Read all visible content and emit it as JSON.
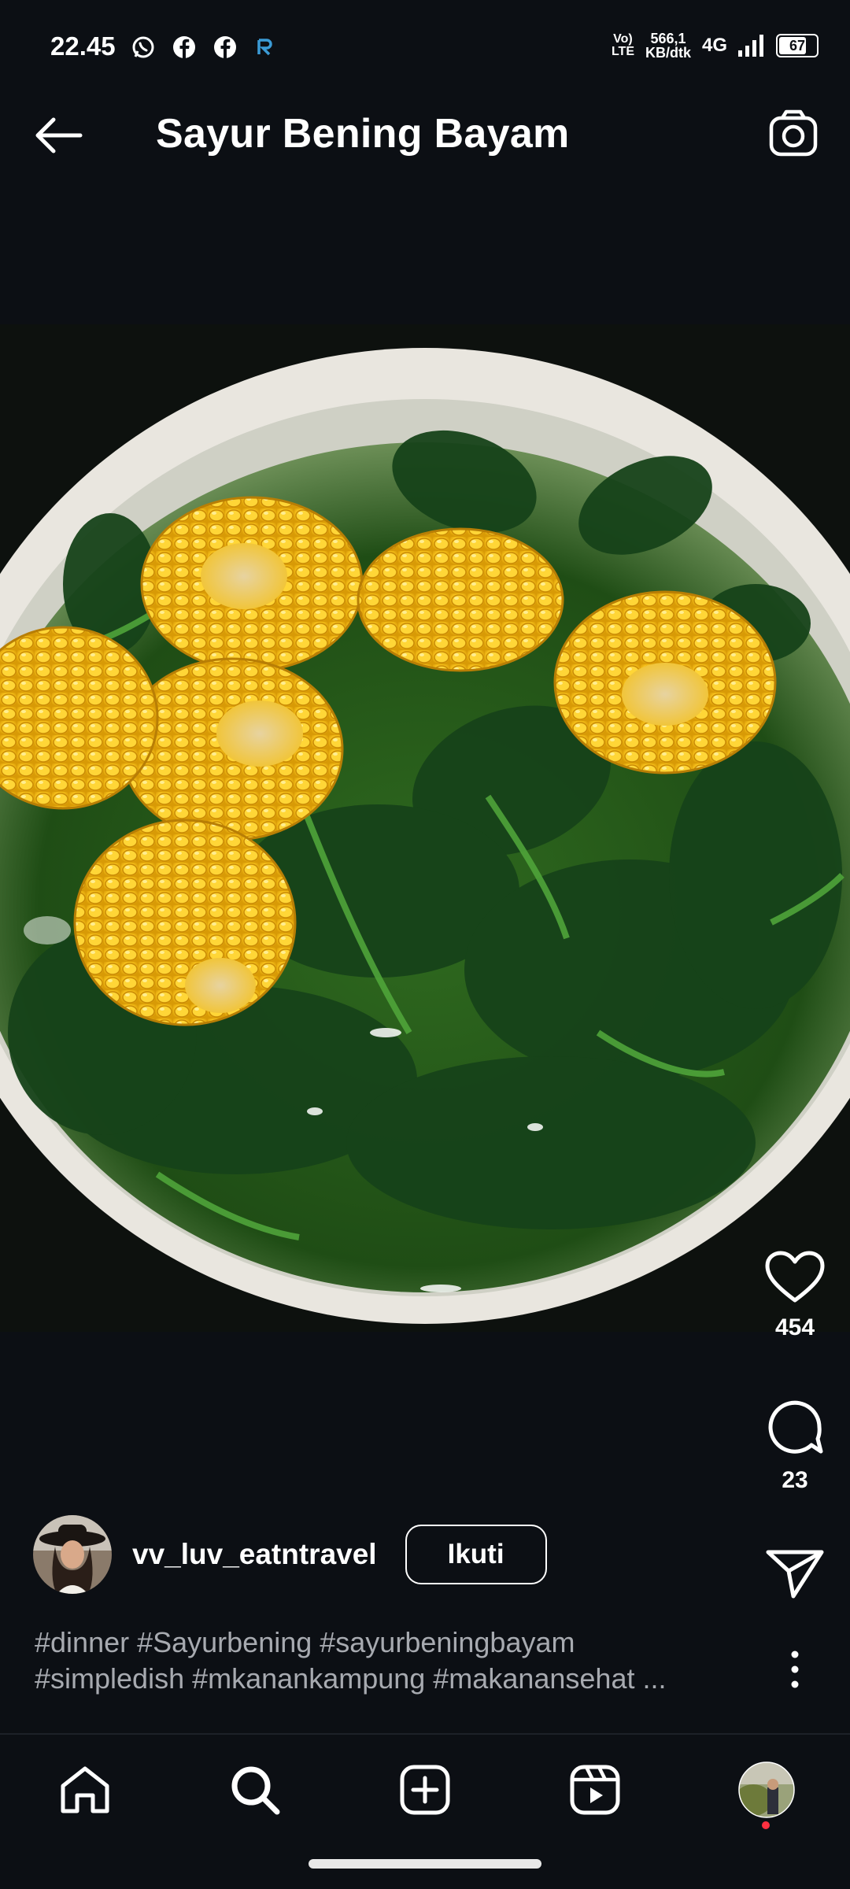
{
  "status_bar": {
    "time": "22.45",
    "icons": [
      "whatsapp-icon",
      "facebook-icon",
      "facebook-icon",
      "cast-icon"
    ],
    "volte": "Vo) LTE",
    "volte_top": "Vo)",
    "volte_bottom": "LTE",
    "net_speed_value": "566,1",
    "net_speed_unit": "KB/dtk",
    "network": "4G",
    "battery": "67"
  },
  "header": {
    "title": "Sayur Bening Bayam",
    "back_icon": "arrow-left-icon",
    "camera_icon": "camera-icon"
  },
  "post": {
    "likes": "454",
    "comments": "23",
    "author": {
      "username": "vv_luv_eatntravel",
      "follow_label": "Ikuti"
    },
    "caption_line1": "#dinner #Sayurbening #sayurbeningbayam",
    "caption_line2": "#simpledish #mkanankampung #makanansehat ..."
  },
  "nav": {
    "items": [
      "home-icon",
      "search-icon",
      "create-icon",
      "reels-icon",
      "profile-avatar"
    ]
  },
  "colors": {
    "background": "#0c0f14",
    "caption": "#a7aab0",
    "notification_dot": "#ff3040"
  }
}
